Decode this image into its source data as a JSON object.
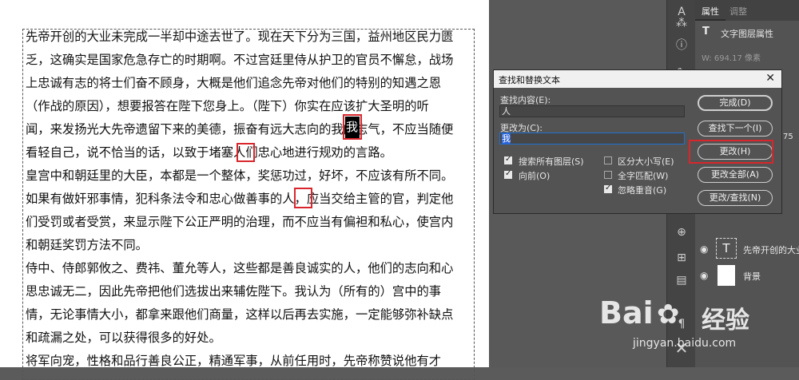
{
  "document": {
    "lines": [
      "先帝开创的大业未完成一半却中途去世了。现在天下分为三国，益州地区民力匮",
      "乏，这确实是国家危急存亡的时期啊。不过宫廷里侍从护卫的官员不懈怠，战场",
      "上忠诚有志的将士们奋不顾身，大概是他们追念先帝对他们的特别的知遇之恩",
      "（作战的原因），想要报答在陛下您身上。（陛下）你实在应该扩大圣明的听",
      "闻，来发扬光大先帝遗留下来的美德，振奋有远大志向的我的志气，不应当随便",
      "看轻自己，说不恰当的话，以致于堵塞人们忠心地进行规劝的言路。",
      "皇宫中和朝廷里的大臣，本都是一个整体，奖惩功过，好坏，不应该有所不同。",
      "如果有做奸邪事情，犯科条法令和忠心做善事的人，应当交给主管的官，判定他",
      "们受罚或者受赏，来显示陛下公正严明的治理，而不应当有偏袒和私心，使宫内",
      "和朝廷奖罚方法不同。",
      "侍中、侍郎郭攸之、费祎、董允等人，这些都是善良诚实的人，他们的志向和心",
      "思忠诚无二，因此先帝把他们选拔出来辅佐陛下。我认为（所有的）宫中的事",
      "情，无论事情大小，都拿来跟他们商量，这样以后再去实施，一定能够弥补缺点",
      "和疏漏之处，可以获得很多的好处。",
      "将军向宠，性格和品行善良公正，精通军事，从前任用时，先帝称赞说他有才"
    ],
    "highlights": [
      "我",
      "人",
      "人"
    ]
  },
  "panel": {
    "tabs": [
      "属性",
      "调整"
    ],
    "properties_title": "文字图层属性",
    "dim_readout": "W: 694.17 像素",
    "value_75": "75",
    "layers": [
      {
        "name": "先帝开创的大业",
        "type": "T"
      },
      {
        "name": "背景",
        "type": "bg"
      }
    ]
  },
  "dialog": {
    "title": "查找和替换文本",
    "find_label": "查找内容(E):",
    "find_value": "人",
    "replace_label": "更改为(C):",
    "replace_value": "我",
    "buttons": {
      "done": "完成(D)",
      "find_next": "查找下一个(I)",
      "change": "更改(H)",
      "change_all": "更改全部(A)",
      "change_find": "更改/查找(N)"
    },
    "options": {
      "search_all_layers": {
        "label": "搜索所有图层(S)",
        "checked": true
      },
      "forward": {
        "label": "向前(O)",
        "checked": true
      },
      "case_sensitive": {
        "label": "区分大小写(E)",
        "checked": false
      },
      "whole_word": {
        "label": "全字匹配(W)",
        "checked": false
      },
      "ignore_accents": {
        "label": "忽略重音(G)",
        "checked": true
      }
    }
  },
  "watermark": {
    "logo": "Bai",
    "logo_suffix": "经验",
    "url": "jingyan.baidu.com"
  },
  "colors": {
    "highlight_red": "#d9262c",
    "selection_blue": "#2b62d9"
  }
}
